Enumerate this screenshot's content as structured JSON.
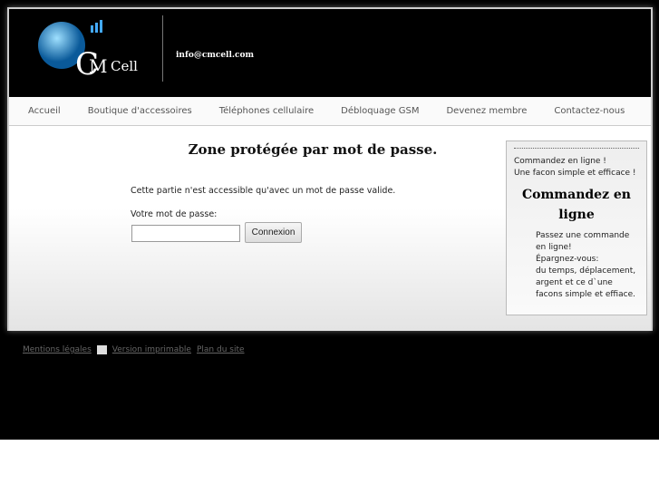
{
  "header": {
    "logo_text": "CMCell",
    "email": "info@cmcell.com"
  },
  "nav": [
    "Accueil",
    "Boutique d'accessoires",
    "Téléphones cellulaire",
    "Débloquage GSM",
    "Devenez membre",
    "Contactez-nous"
  ],
  "main": {
    "title": "Zone protégée par mot de passe.",
    "message": "Cette partie n'est accessible qu'avec un mot de passe valide.",
    "password_label": "Votre mot de passe:",
    "password_value": "",
    "login_button": "Connexion"
  },
  "sidebar": {
    "line1": "Commandez en ligne !",
    "line2": "Une facon simple et efficace !",
    "heading": "Commandez en ligne",
    "body": [
      "Passez une commande en ligne!",
      "Épargnez-vous:",
      "du temps, déplacement, argent et ce d`une facons simple et effiace."
    ]
  },
  "footer": {
    "legal": "Mentions légales",
    "print": "Version imprimable",
    "sitemap": "Plan du site"
  }
}
